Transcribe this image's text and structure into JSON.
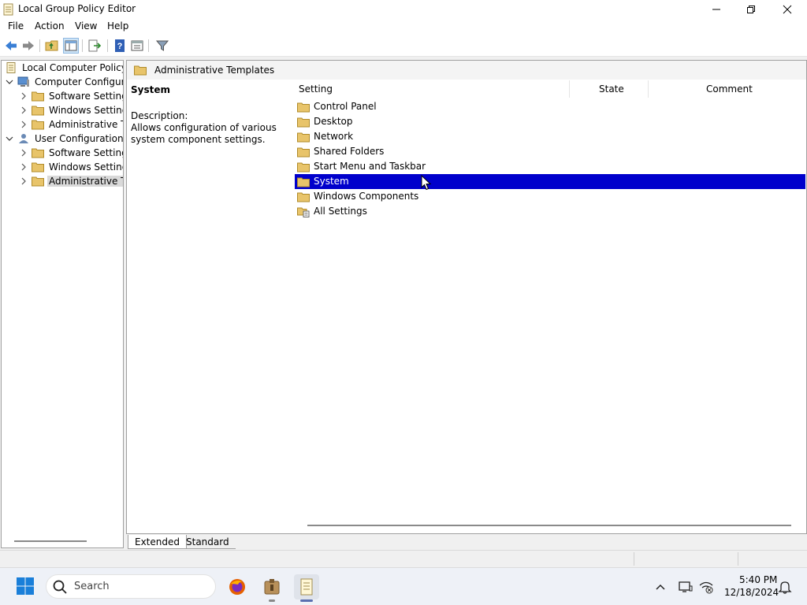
{
  "window": {
    "title": "Local Group Policy Editor"
  },
  "menu": {
    "file": "File",
    "action": "Action",
    "view": "View",
    "help": "Help"
  },
  "tree": {
    "root": "Local Computer Policy",
    "computer_config": "Computer Configura",
    "cc_software": "Software Settings",
    "cc_windows": "Windows Setting",
    "cc_admin": "Administrative Te",
    "user_config": "User Configuration",
    "uc_software": "Software Settings",
    "uc_windows": "Windows Setting",
    "uc_admin": "Administrative Te"
  },
  "right_pane": {
    "header": "Administrative Templates",
    "desc_title": "System",
    "desc_label": "Description:",
    "desc_text": "Allows configuration of various system component settings.",
    "columns": {
      "setting": "Setting",
      "state": "State",
      "comment": "Comment"
    },
    "items": [
      "Control Panel",
      "Desktop",
      "Network",
      "Shared Folders",
      "Start Menu and Taskbar",
      "System",
      "Windows Components",
      "All Settings"
    ],
    "selected_item": "System"
  },
  "tabs": {
    "extended": "Extended",
    "standard": "Standard"
  },
  "taskbar": {
    "search_placeholder": "Search",
    "time": "5:40 PM",
    "date": "12/18/2024"
  },
  "colors": {
    "selection": "#0000cc",
    "folder": "#e8c46a"
  }
}
